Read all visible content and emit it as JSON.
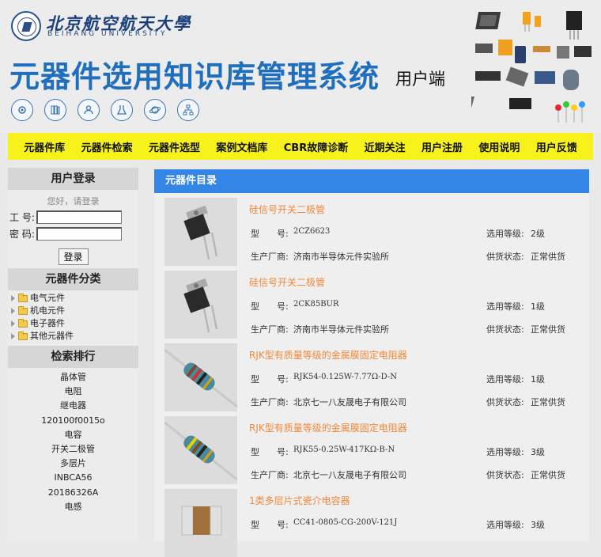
{
  "header": {
    "university_cn": "北京航空航天大學",
    "university_en": "BEIHANG UNIVERSITY",
    "system_title": "元器件选用知识库管理系统",
    "system_subtitle": "用户端",
    "icon_buttons": [
      "gear-icon",
      "books-icon",
      "user-icon",
      "chemistry-icon",
      "planet-icon",
      "network-icon"
    ]
  },
  "nav": [
    "元器件库",
    "元器件检索",
    "元器件选型",
    "案例文档库",
    "CBR故障诊断",
    "近期关注",
    "用户注册",
    "使用说明",
    "用户反馈"
  ],
  "login": {
    "heading": "用户登录",
    "hint": "您好，请登录",
    "id_label": "工 号:",
    "password_label": "密 码:",
    "id_value": "",
    "password_value": "",
    "button": "登录"
  },
  "categories": {
    "heading": "元器件分类",
    "items": [
      "电气元件",
      "机电元件",
      "电子器件",
      "其他元器件"
    ]
  },
  "ranking": {
    "heading": "检索排行",
    "items": [
      "晶体管",
      "电阻",
      "继电器",
      "120100f0015o",
      "电容",
      "开关二极管",
      "多层片",
      "INBCA56",
      "20186326A",
      "电感"
    ]
  },
  "catalog": {
    "heading": "元器件目录",
    "labels": {
      "model": "型　　号:",
      "grade": "选用等级:",
      "maker": "生产厂商:",
      "supply": "供货状态:"
    },
    "items": [
      {
        "title": "硅信号开关二极管",
        "model": "2CZ6623",
        "grade": "2级",
        "maker": "济南市半导体元件实验所",
        "supply": "正常供货",
        "image": "diode"
      },
      {
        "title": "硅信号开关二极管",
        "model": "2CK85BUR",
        "grade": "1级",
        "maker": "济南市半导体元件实验所",
        "supply": "正常供货",
        "image": "diode"
      },
      {
        "title": "RJK型有质量等级的金属膜固定电阻器",
        "model": "RJK54-0.125W-7.77Ω-D-N",
        "grade": "1级",
        "maker": "北京七一八友晟电子有限公司",
        "supply": "正常供货",
        "image": "resistor"
      },
      {
        "title": "RJK型有质量等级的金属膜固定电阻器",
        "model": "RJK55-0.25W-417KΩ-B-N",
        "grade": "3级",
        "maker": "北京七一八友晟电子有限公司",
        "supply": "正常供货",
        "image": "resistor"
      },
      {
        "title": "1类多层片式瓷介电容器",
        "model": "CC41-0805-CG-200V-121J",
        "grade": "3级",
        "maker": "",
        "supply": "",
        "image": "capacitor"
      }
    ]
  }
}
